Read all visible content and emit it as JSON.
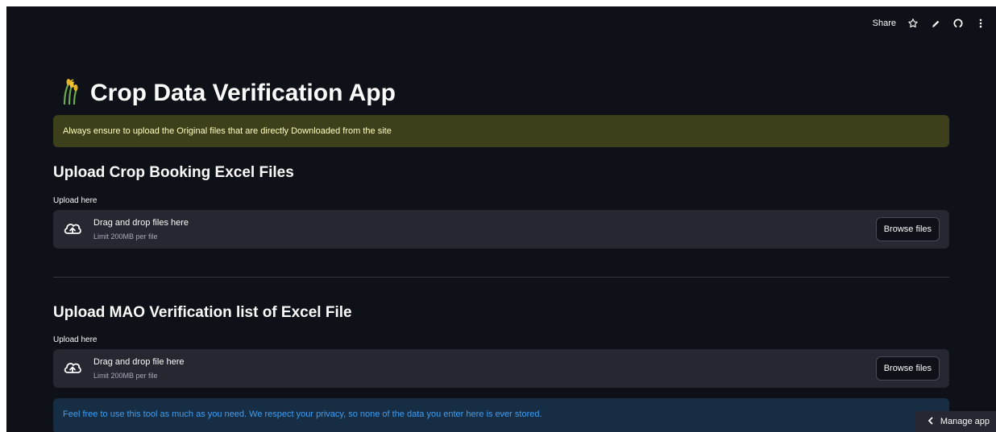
{
  "toolbar": {
    "share_label": "Share",
    "icons": [
      "star-icon",
      "edit-icon",
      "github-icon",
      "more-icon"
    ]
  },
  "header": {
    "title": "Crop Data Verification App",
    "icon": "wheat-icon"
  },
  "warning": {
    "text": "Always ensure to upload the Original files that are directly Downloaded from the site"
  },
  "sections": [
    {
      "title": "Upload Crop Booking Excel Files",
      "upload_label": "Upload here",
      "drop_text": "Drag and drop files here",
      "limit_text": "Limit 200MB per file",
      "button_label": "Browse files"
    },
    {
      "title": "Upload MAO Verification list of Excel File",
      "upload_label": "Upload here",
      "drop_text": "Drag and drop file here",
      "limit_text": "Limit 200MB per file",
      "button_label": "Browse files"
    }
  ],
  "info": {
    "text": "Feel free to use this tool as much as you need. We respect your privacy, so none of the data you enter here is ever stored."
  },
  "manage_app": {
    "label": "Manage app"
  },
  "colors": {
    "background": "#0e1117",
    "warning_bg": "#3e3f1b",
    "warning_text": "#ffffc2",
    "info_bg": "#172d43",
    "info_text": "#3d9df3",
    "dropzone_bg": "#262730"
  }
}
